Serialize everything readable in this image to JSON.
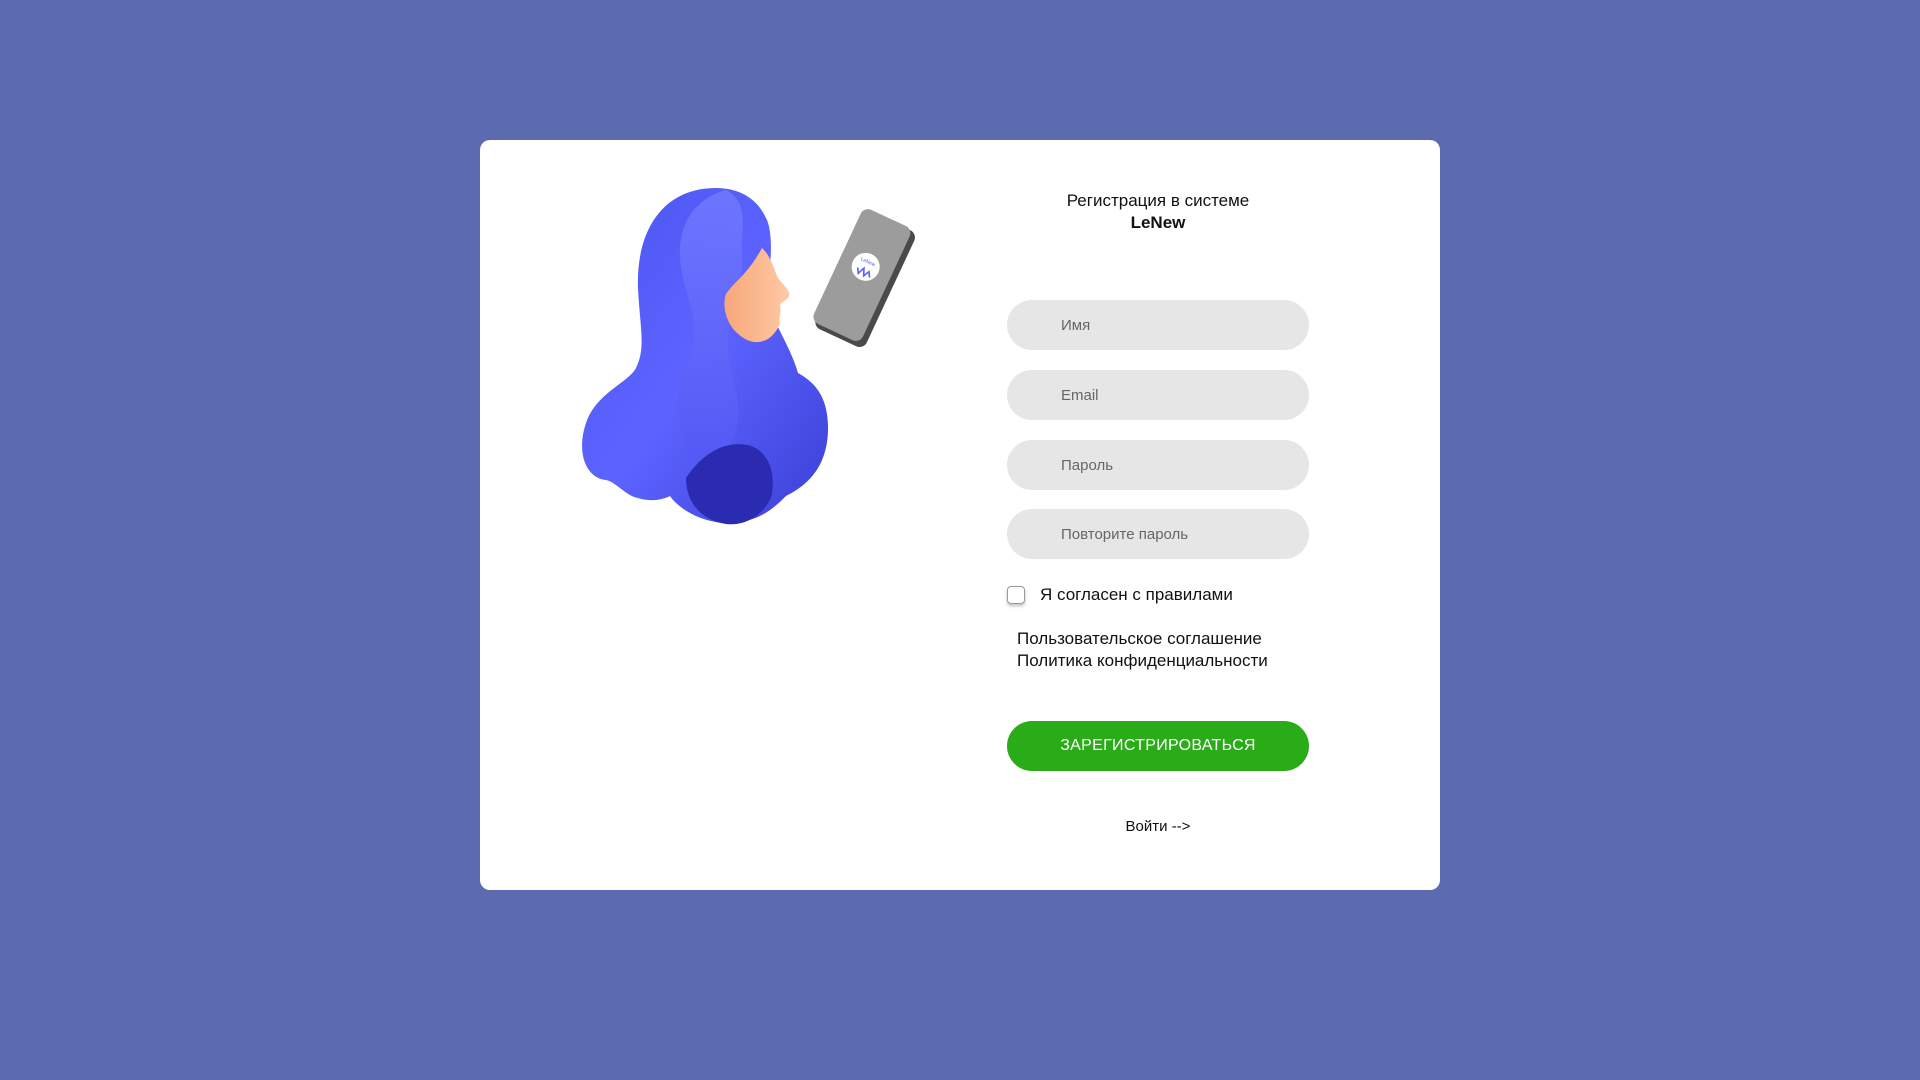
{
  "colors": {
    "background": "#5c6bb0",
    "card": "#ffffff",
    "field": "#e6e6e6",
    "accent_button": "#2aab18",
    "hair": "#5b5cff"
  },
  "illustration": {
    "icon": "woman-with-phone-illustration",
    "phone_logo_text": "LeNew"
  },
  "header": {
    "title_line1": "Регистрация в системе",
    "title_brand": "LeNew"
  },
  "form": {
    "name_placeholder": "Имя",
    "email_placeholder": "Email",
    "password_placeholder": "Пароль",
    "repeat_password_placeholder": "Повторите пароль",
    "agree_label": "Я согласен с правилами",
    "user_agreement_link": "Пользовательское соглашение",
    "privacy_policy_link": "Политика конфиденциальности",
    "submit_label": "ЗАРЕГИСТРИРОВАТЬСЯ",
    "login_link": "Войти -->"
  }
}
